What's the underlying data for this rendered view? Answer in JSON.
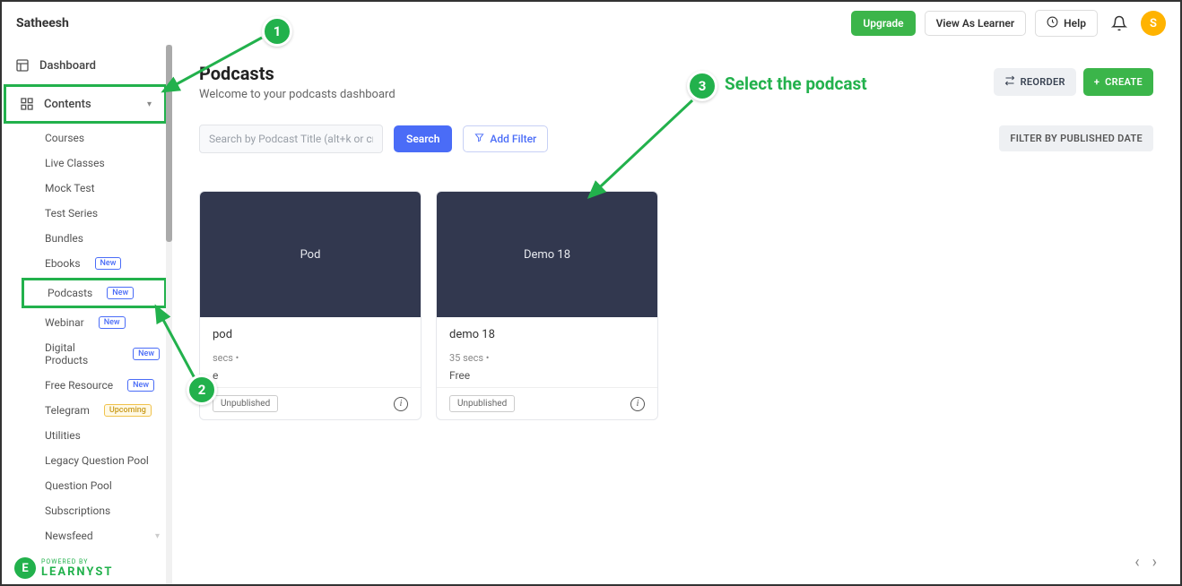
{
  "brand": "Satheesh",
  "header": {
    "upgrade": "Upgrade",
    "view_learner": "View As Learner",
    "help": "Help",
    "avatar_initial": "S"
  },
  "sidebar": {
    "dashboard": "Dashboard",
    "contents": "Contents",
    "items": [
      {
        "label": "Courses",
        "tag": ""
      },
      {
        "label": "Live Classes",
        "tag": ""
      },
      {
        "label": "Mock Test",
        "tag": ""
      },
      {
        "label": "Test Series",
        "tag": ""
      },
      {
        "label": "Bundles",
        "tag": ""
      },
      {
        "label": "Ebooks",
        "tag": "New"
      },
      {
        "label": "Podcasts",
        "tag": "New"
      },
      {
        "label": "Webinar",
        "tag": "New"
      },
      {
        "label": "Digital Products",
        "tag": "New"
      },
      {
        "label": "Free Resource",
        "tag": "New"
      },
      {
        "label": "Telegram",
        "tag": "Upcoming"
      },
      {
        "label": "Utilities",
        "tag": ""
      },
      {
        "label": "Legacy Question Pool",
        "tag": ""
      },
      {
        "label": "Question Pool",
        "tag": ""
      },
      {
        "label": "Subscriptions",
        "tag": ""
      },
      {
        "label": "Newsfeed",
        "tag": ""
      }
    ]
  },
  "page": {
    "title": "Podcasts",
    "subtitle": "Welcome to your podcasts dashboard",
    "search_placeholder": "Search by Podcast Title (alt+k or cmd+k)",
    "search_btn": "Search",
    "add_filter": "Add Filter",
    "reorder": "REORDER",
    "create": "CREATE",
    "filter_date": "FILTER BY PUBLISHED DATE"
  },
  "cards": [
    {
      "thumb": "Pod",
      "name": "pod",
      "meta": "secs  •",
      "price": "e",
      "status": "Unpublished"
    },
    {
      "thumb": "Demo 18",
      "name": "demo 18",
      "meta": "35 secs  •",
      "price": "Free",
      "status": "Unpublished"
    }
  ],
  "footer": {
    "badge": "E",
    "powered": "POWERED BY",
    "brand": "LEARNYST"
  },
  "annotations": {
    "n1": "1",
    "n2": "2",
    "n3": "3",
    "label3": "Select the podcast"
  }
}
